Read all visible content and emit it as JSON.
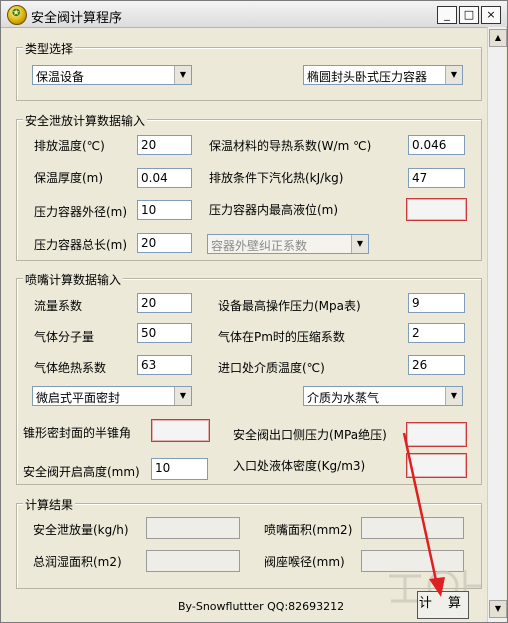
{
  "window": {
    "title": "安全阀计算程序",
    "minimize": "_",
    "maximize": "□",
    "close": "×"
  },
  "type_group": {
    "title": "类型选择",
    "left_select": "保温设备",
    "right_select": "椭圆封头卧式压力容器"
  },
  "relief": {
    "title": "安全泄放计算数据输入",
    "discharge_temp": {
      "label": "排放温度(℃)",
      "value": "20"
    },
    "insulation_conductivity": {
      "label": "保温材料的导热系数(W/m ℃)",
      "value": "0.046"
    },
    "insulation_thickness": {
      "label": "保温厚度(m)",
      "value": "0.04"
    },
    "latent_heat": {
      "label": "排放条件下汽化热(kJ/kg)",
      "value": "47"
    },
    "vessel_diameter": {
      "label": "压力容器外径(m)",
      "value": "10"
    },
    "max_level": {
      "label": "压力容器内最高液位(m)",
      "value": ""
    },
    "vessel_length": {
      "label": "压力容器总长(m)",
      "value": "20"
    },
    "correction_select": "容器外壁纠正系数"
  },
  "nozzle": {
    "title": "喷嘴计算数据输入",
    "flow_coef": {
      "label": "流量系数",
      "value": "20"
    },
    "max_pressure": {
      "label": "设备最高操作压力(Mpa表)",
      "value": "9"
    },
    "molecular_weight": {
      "label": "气体分子量",
      "value": "50"
    },
    "compress_factor": {
      "label": "气体在Pm时的压缩系数",
      "value": "2"
    },
    "adiabatic": {
      "label": "气体绝热系数",
      "value": "63"
    },
    "inlet_temp": {
      "label": "进口处介质温度(℃)",
      "value": "26"
    },
    "seal_select": "微启式平面密封",
    "medium_select": "介质为水蒸气",
    "half_cone_angle": {
      "label": "锥形密封面的半锥角",
      "value": ""
    },
    "outlet_pressure": {
      "label": "安全阀出口侧压力(MPa绝压)",
      "value": ""
    },
    "lift_height": {
      "label": "安全阀开启高度(mm)",
      "value": "10"
    },
    "inlet_density": {
      "label": "入口处液体密度(Kg/m3)",
      "value": ""
    }
  },
  "results": {
    "title": "计算结果",
    "relief_rate": "安全泄放量(kg/h)",
    "nozzle_area": "喷嘴面积(mm2)",
    "wetted_area": "总润湿面积(m2)",
    "seat_throat": "阀座喉径(mm)"
  },
  "credit": "By-Snowfluttter  QQ:82693212",
  "calc_button": "计 算",
  "colors": {
    "window_bg": "#ece9d8",
    "invalid_border": "#c83a3a",
    "arrow": "#e02020"
  }
}
